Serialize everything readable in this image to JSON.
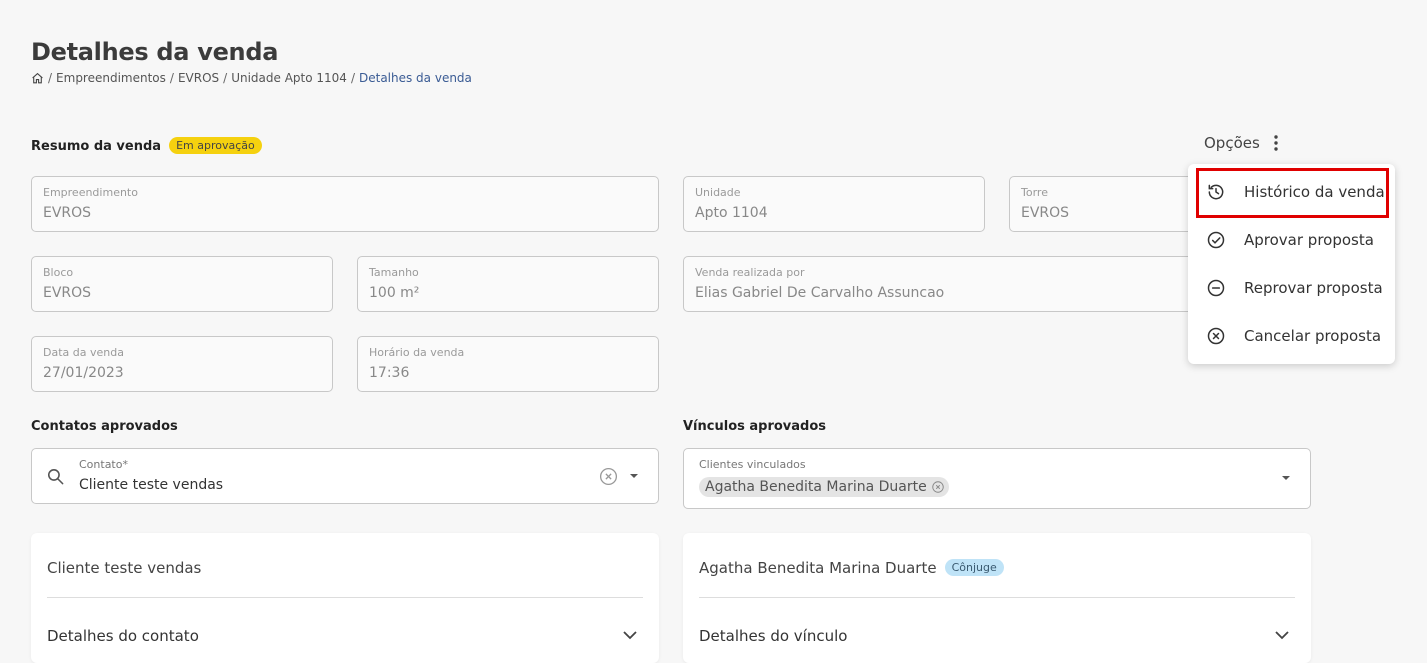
{
  "header": {
    "title": "Detalhes da venda",
    "breadcrumb": [
      "Empreendimentos",
      "EVROS",
      "Unidade Apto 1104",
      "Detalhes da venda"
    ]
  },
  "resumo": {
    "title": "Resumo da venda",
    "status": "Em aprovação"
  },
  "options": {
    "label": "Opções",
    "menu": [
      {
        "label": "Histórico da venda",
        "icon": "history-icon"
      },
      {
        "label": "Aprovar proposta",
        "icon": "check-circle-icon"
      },
      {
        "label": "Reprovar proposta",
        "icon": "minus-circle-icon"
      },
      {
        "label": "Cancelar proposta",
        "icon": "x-circle-icon"
      }
    ]
  },
  "fields": {
    "empreendimento": {
      "label": "Empreendimento",
      "value": "EVROS"
    },
    "unidade": {
      "label": "Unidade",
      "value": "Apto 1104"
    },
    "torre": {
      "label": "Torre",
      "value": "EVROS"
    },
    "bloco": {
      "label": "Bloco",
      "value": "EVROS"
    },
    "tamanho": {
      "label": "Tamanho",
      "value": "100 m²"
    },
    "vendedor": {
      "label": "Venda realizada por",
      "value": "Elias Gabriel De Carvalho Assuncao"
    },
    "data": {
      "label": "Data da venda",
      "value": "27/01/2023"
    },
    "horario": {
      "label": "Horário da venda",
      "value": "17:36"
    }
  },
  "contatos": {
    "title": "Contatos aprovados",
    "label": "Contato*",
    "value": "Cliente teste vendas"
  },
  "vinculos": {
    "title": "Vínculos aprovados",
    "label": "Clientes vinculados",
    "chip": "Agatha Benedita Marina Duarte"
  },
  "cards": {
    "contato": {
      "name": "Cliente teste vendas",
      "details": "Detalhes do contato"
    },
    "vinculo": {
      "name": "Agatha Benedita Marina Duarte",
      "tag": "Cônjuge",
      "details": "Detalhes do vínculo"
    }
  },
  "colors": {
    "badge": "#f5d10f",
    "tag": "#bfe3f7",
    "link": "#3a5b94",
    "highlight": "#e00000"
  }
}
